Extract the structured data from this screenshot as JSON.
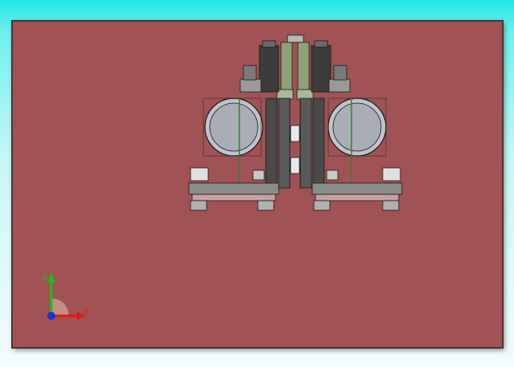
{
  "viewport": {
    "background": "#a15254"
  },
  "triad": {
    "x_label": "X",
    "y_label": "Y",
    "x_color": "#e01818",
    "y_color": "#18c018",
    "z_color": "#1830e0"
  }
}
